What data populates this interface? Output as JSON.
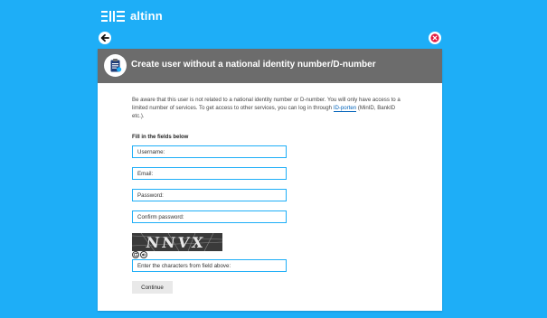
{
  "header": {
    "brand_name": "altinn",
    "logo_icon": "altinn-logo-icon"
  },
  "nav": {
    "back_icon": "arrow-left-icon",
    "close_icon": "close-icon",
    "close_color": "#e3173e"
  },
  "dialog": {
    "title": "Create user without a national identity number/D-number",
    "icon": "clipboard-user-icon",
    "intro_before_link": "Be aware that this user is not related to a national identity number or D-number. You will only have access to a limited number of services. To get access to other services, you can log in through ",
    "intro_link": "ID-porten",
    "intro_after_link": " (MinID, BankID etc.).",
    "section_label": "Fill in the fields below",
    "fields": {
      "username": {
        "placeholder": "Username:",
        "value": ""
      },
      "email": {
        "placeholder": "Email:",
        "value": ""
      },
      "password": {
        "placeholder": "Password:",
        "value": ""
      },
      "confirm_password": {
        "placeholder": "Confirm password:",
        "value": ""
      },
      "captcha_answer": {
        "placeholder": "Enter the characters from field above:",
        "value": ""
      }
    },
    "captcha": {
      "text": "NNVX",
      "refresh_icon": "refresh-icon",
      "audio_icon": "audio-icon"
    },
    "continue_label": "Continue"
  },
  "colors": {
    "background": "#1eaef7",
    "header_bar": "#6c6c6c",
    "field_border": "#1eaef7",
    "link": "#0062ba",
    "button": "#e9e9e9"
  }
}
